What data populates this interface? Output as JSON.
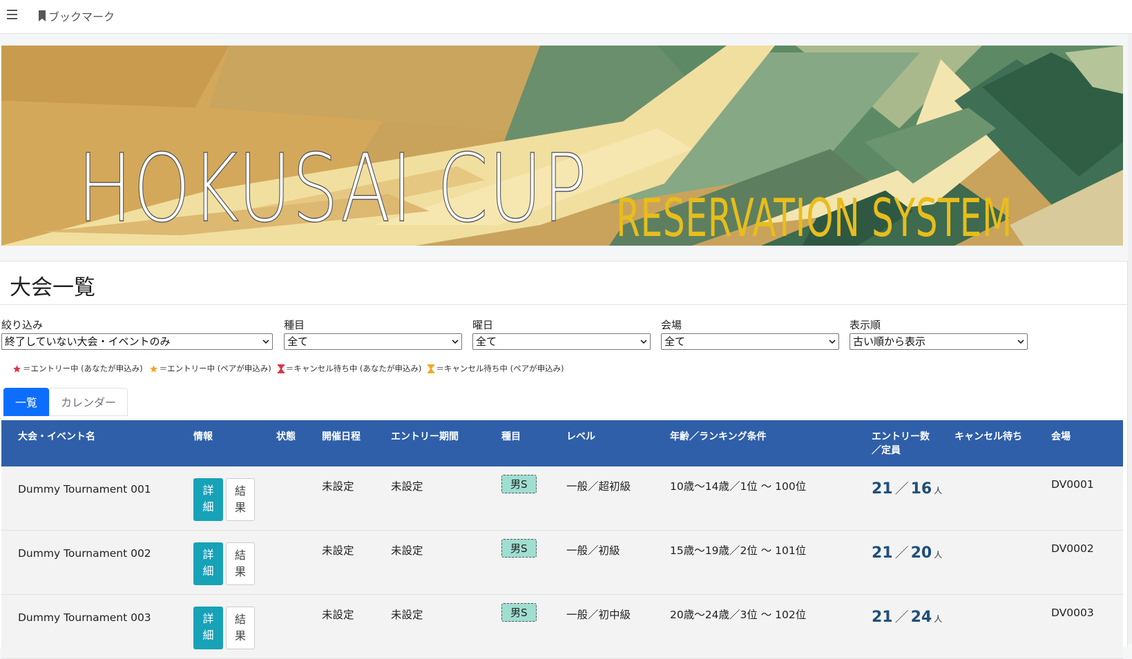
{
  "topbar": {
    "bookmark_label": "ブックマーク"
  },
  "banner": {
    "title": "HOKUSAI CUP",
    "subtitle": "RESERVATION SYSTEM"
  },
  "page_title": "大会一覧",
  "filters": [
    {
      "label": "絞り込み",
      "value": "終了していない大会・イベントのみ"
    },
    {
      "label": "種目",
      "value": "全て"
    },
    {
      "label": "曜日",
      "value": "全て"
    },
    {
      "label": "会場",
      "value": "全て"
    },
    {
      "label": "表示順",
      "value": "古い順から表示"
    }
  ],
  "legend": [
    {
      "icon": "star-icon",
      "color": "#dc3545",
      "text": "＝エントリー中 (あなたが申込み)"
    },
    {
      "icon": "star-icon",
      "color": "#f5a623",
      "text": "＝エントリー中 (ペアが申込み)"
    },
    {
      "icon": "hourglass-icon",
      "color": "#dc3545",
      "text": "＝キャンセル待ち中 (あなたが申込み)"
    },
    {
      "icon": "hourglass-icon",
      "color": "#f5a623",
      "text": "＝キャンセル待ち中 (ペアが申込み)"
    }
  ],
  "tabs": [
    {
      "label": "一覧",
      "active": true
    },
    {
      "label": "カレンダー",
      "active": false
    }
  ],
  "table": {
    "headers": {
      "name": "大会・イベント名",
      "info": "情報",
      "status": "状態",
      "schedule": "開催日程",
      "entry_period": "エントリー期間",
      "event": "種目",
      "level": "レベル",
      "conditions": "年齢／ランキング条件",
      "entries_line1": "エントリー数",
      "entries_line2": "／定員",
      "waitlist": "キャンセル待ち",
      "venue": "会場"
    },
    "detail_label_1": "詳",
    "detail_label_2": "細",
    "result_label_1": "結",
    "result_label_2": "果",
    "unit": "人",
    "rows": [
      {
        "name": "Dummy Tournament 001",
        "schedule": "未設定",
        "entry_period": "未設定",
        "event": "男S",
        "level": "一般／超初級",
        "conditions": "10歳〜14歳／1位 〜 100位",
        "entries": "21",
        "capacity": "16",
        "venue": "DV0001"
      },
      {
        "name": "Dummy Tournament 002",
        "schedule": "未設定",
        "entry_period": "未設定",
        "event": "男S",
        "level": "一般／初級",
        "conditions": "15歳〜19歳／2位 〜 101位",
        "entries": "21",
        "capacity": "20",
        "venue": "DV0002"
      },
      {
        "name": "Dummy Tournament 003",
        "schedule": "未設定",
        "entry_period": "未設定",
        "event": "男S",
        "level": "一般／初中級",
        "conditions": "20歳〜24歳／3位 〜 102位",
        "entries": "21",
        "capacity": "24",
        "venue": "DV0003"
      }
    ]
  }
}
